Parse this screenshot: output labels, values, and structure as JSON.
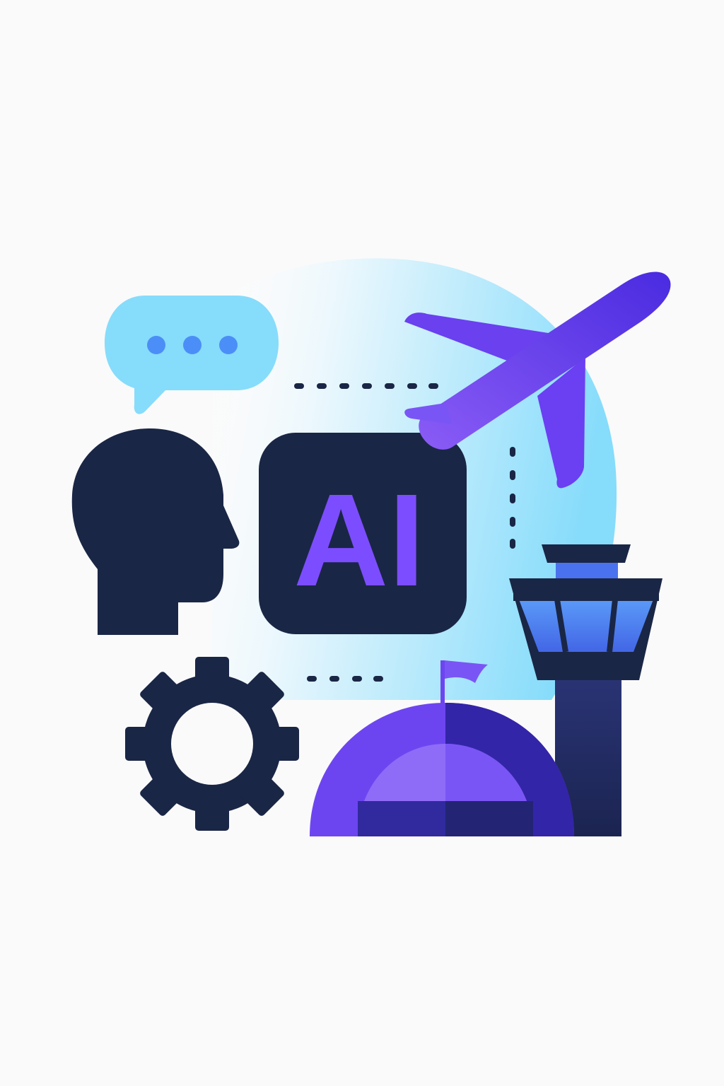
{
  "illustration": {
    "ai_badge": {
      "label": "AI"
    },
    "icons": [
      "speech-bubble-icon",
      "head-profile-icon",
      "ai-chip-icon",
      "airplane-icon",
      "gear-icon",
      "control-tower-icon",
      "hangar-dome-icon",
      "flag-icon"
    ],
    "colors": {
      "background": "#fafafa",
      "navy": "#1a2645",
      "purple": "#6f47f0",
      "violet": "#7c5cff",
      "deep_purple": "#3325a8",
      "sky_blue": "#86dcfb",
      "blue": "#4f86f7",
      "dot_blue": "#4c8ef7"
    }
  }
}
